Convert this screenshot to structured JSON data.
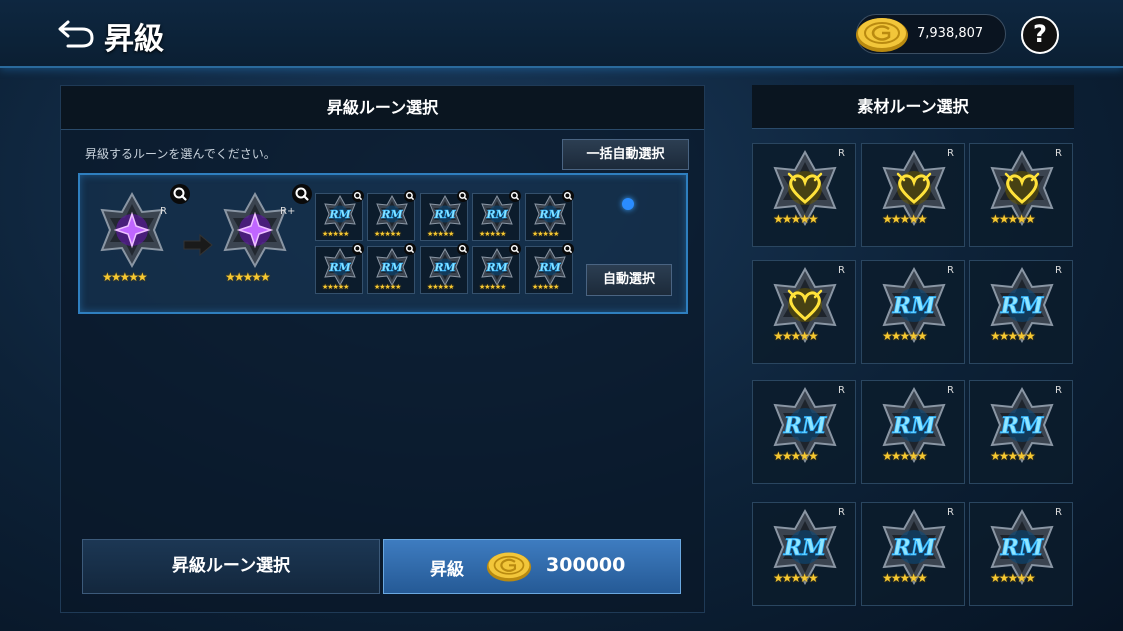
{
  "header": {
    "title": "昇級",
    "gold_amount": "7,938,807",
    "help_label": "?"
  },
  "left_panel": {
    "title": "昇級ルーン選択",
    "instruction": "昇級するルーンを選んでください。",
    "auto_select_all_label": "一括自動選択",
    "auto_select_label": "自動選択",
    "source_rune_rank": "R",
    "target_rune_rank": "R+",
    "source_rune_stars": "★★★★★",
    "target_rune_stars": "★★★★★",
    "material_slot_count": 10,
    "rune_select_button": "昇級ルーン選択",
    "upgrade_button_label": "昇級",
    "upgrade_cost": "300000"
  },
  "right_panel": {
    "title": "素材ルーン選択",
    "runes": [
      {
        "type": "heart",
        "rank": "R",
        "stars": "★★★★★"
      },
      {
        "type": "heart",
        "rank": "R",
        "stars": "★★★★★"
      },
      {
        "type": "heart",
        "rank": "R",
        "stars": "★★★★★"
      },
      {
        "type": "heart",
        "rank": "R",
        "stars": "★★★★★"
      },
      {
        "type": "rm",
        "rank": "R",
        "stars": "★★★★★"
      },
      {
        "type": "rm",
        "rank": "R",
        "stars": "★★★★★"
      },
      {
        "type": "rm",
        "rank": "R",
        "stars": "★★★★★"
      },
      {
        "type": "rm",
        "rank": "R",
        "stars": "★★★★★"
      },
      {
        "type": "rm",
        "rank": "R",
        "stars": "★★★★★"
      },
      {
        "type": "rm",
        "rank": "R",
        "stars": "★★★★★"
      },
      {
        "type": "rm",
        "rank": "R",
        "stars": "★★★★★"
      },
      {
        "type": "rm",
        "rank": "R",
        "stars": "★★★★★"
      }
    ]
  },
  "colors": {
    "accent_blue": "#2f7fbf",
    "gold": "#f5c832",
    "purple_rune": "#b44cff",
    "cyan_rune": "#3ad0ff",
    "yellow_rune": "#ffe23a"
  }
}
